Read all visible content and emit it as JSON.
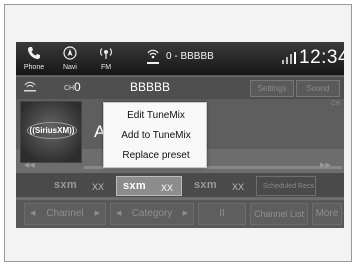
{
  "status_bar": {
    "phone_label": "Phone",
    "navi_label": "Navi",
    "fm_label": "FM",
    "source_label": "0 - BBBBB",
    "clock": "12:34"
  },
  "channel": {
    "prefix": "CH",
    "number": "0",
    "name": "BBBBB",
    "settings_label": "Settings",
    "sound_label": "Sound",
    "tag": "CH"
  },
  "content": {
    "logo_text": "((SiriusXM))",
    "song_text": "A"
  },
  "progress": {
    "fraction": 0.0
  },
  "presets": [
    {
      "logo": "sxm",
      "name": "XX"
    },
    {
      "logo": "sxm",
      "name": "XX"
    },
    {
      "logo": "sxm",
      "name": "XX"
    },
    {
      "name": "Scheduled Recs"
    }
  ],
  "bottom": {
    "channel_label": "Channel",
    "category_label": "Category",
    "pause_label": "II",
    "channel_list_label": "Channel List",
    "more_label": "More"
  },
  "popup": {
    "items": [
      "Edit TuneMix",
      "Add to TuneMix",
      "Replace preset"
    ]
  },
  "colors": {
    "accent": "#ffffff",
    "background": "#6d6d6d"
  }
}
